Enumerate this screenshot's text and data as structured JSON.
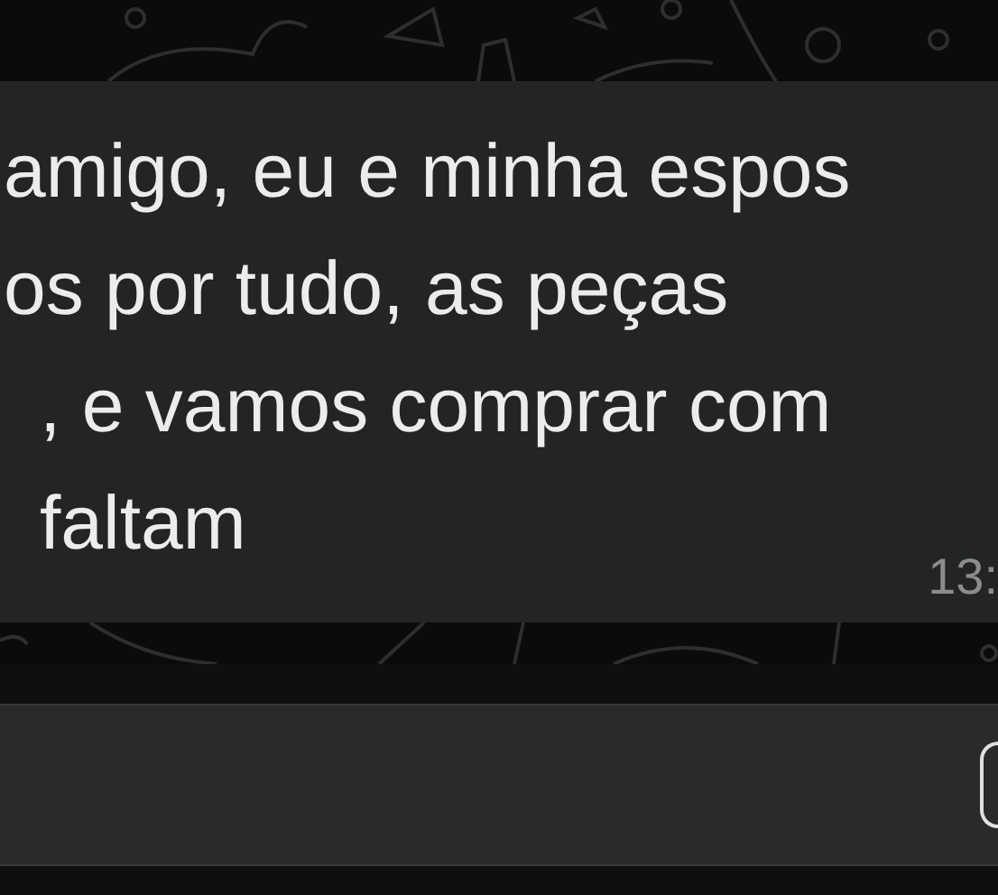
{
  "message": {
    "lines": [
      "amigo, eu e minha espos",
      "os por tudo, as peças",
      ", e vamos comprar com",
      "faltam"
    ],
    "time": "13:"
  }
}
